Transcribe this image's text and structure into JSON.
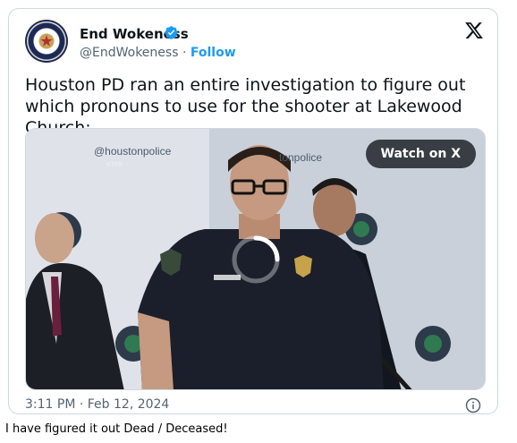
{
  "tweet": {
    "author_name": "End Wokeness",
    "handle": "@EndWokeness",
    "separator": "·",
    "follow_label": "Follow",
    "text": "Houston PD ran an entire investigation to figure out which pronouns to use for the shooter at Lakewood Church:",
    "timestamp": "3:11 PM · Feb 12, 2024"
  },
  "media": {
    "watch_label": "Watch on X",
    "watermark_main": "@houstonpolice",
    "watermark_sub": "KTRK",
    "watermark_mid": "tonpolice",
    "state": "loading"
  },
  "caption": "I have figured it out Dead / Deceased!",
  "icons": {
    "verified": "verified-badge-icon",
    "x_logo": "x-logo-icon",
    "info": "info-icon",
    "loading": "loading-spinner-icon"
  },
  "colors": {
    "accent": "#1d9bf0",
    "text": "#0f1419",
    "muted": "#536471",
    "border": "#cfd9de"
  }
}
